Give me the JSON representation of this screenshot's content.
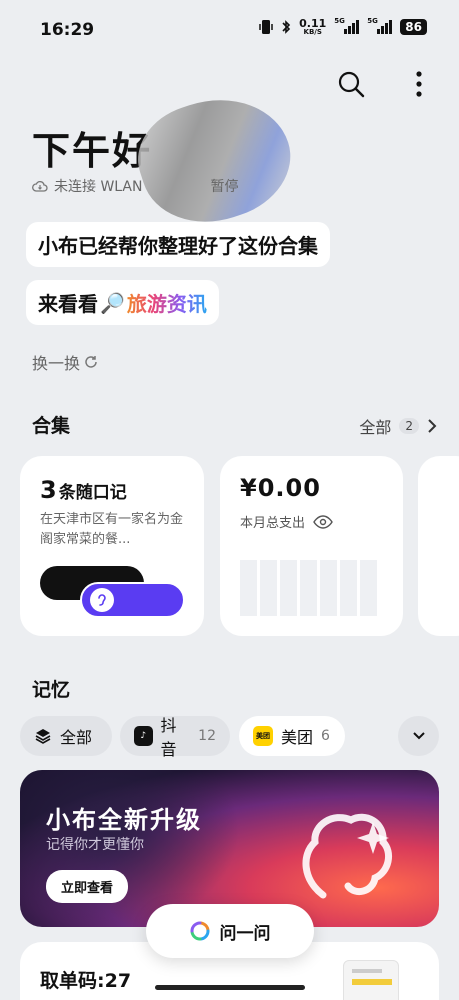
{
  "status_bar": {
    "time": "16:29",
    "net_speed": "0.11",
    "net_unit": "KB/S",
    "sim1": "5G",
    "sim2": "5G",
    "battery": "86"
  },
  "header": {
    "greeting": "下午好",
    "wifi_status": "未连接 WLAN",
    "wifi_extra": "暂停"
  },
  "suggestion": {
    "line1": "小布已经帮你整理好了这份合集",
    "line2_prefix": "来看看",
    "line2_emoji": "🔎",
    "line2_topic": "旅游资讯",
    "shuffle_label": "换一换"
  },
  "collections": {
    "title": "合集",
    "all_label": "全部",
    "all_count": "2",
    "notes_card": {
      "count": "3",
      "label": "条随口记",
      "text": "在天津市区有一家名为金阁家常菜的餐..."
    },
    "spend_card": {
      "amount": "¥0.00",
      "label": "本月总支出"
    }
  },
  "memory": {
    "title": "记忆",
    "filters": [
      {
        "label": "全部",
        "count": ""
      },
      {
        "label": "抖音",
        "count": "12"
      },
      {
        "label": "美团",
        "count": "6"
      }
    ],
    "douyin_icon_glyph": "♪",
    "meituan_icon_text": "美团"
  },
  "banner": {
    "title": "小布全新升级",
    "subtitle": "记得你才更懂你",
    "button": "立即查看"
  },
  "ask_button": "问一问",
  "bottom_card": {
    "title": "取单码:27"
  },
  "colors": {
    "background": "#eceef1",
    "accent_purple": "#5a3cf2",
    "meituan_yellow": "#ffd100"
  }
}
